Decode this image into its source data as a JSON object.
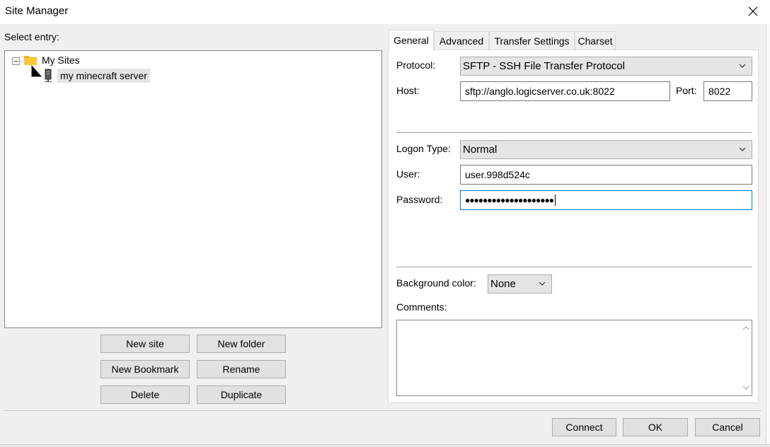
{
  "window": {
    "title": "Site Manager"
  },
  "tree": {
    "label": "Select entry:",
    "root": {
      "label": "My Sites",
      "expanded": true
    },
    "site": {
      "label": "my minecraft server"
    }
  },
  "left_buttons": {
    "new_site": "New site",
    "new_folder": "New folder",
    "new_bookmark": "New Bookmark",
    "rename": "Rename",
    "delete": "Delete",
    "duplicate": "Duplicate"
  },
  "tabs": [
    {
      "label": "General",
      "active": true
    },
    {
      "label": "Advanced",
      "active": false
    },
    {
      "label": "Transfer Settings",
      "active": false
    },
    {
      "label": "Charset",
      "active": false
    }
  ],
  "general": {
    "protocol_label": "Protocol:",
    "protocol_value": "SFTP - SSH File Transfer Protocol",
    "host_label": "Host:",
    "host_value": "sftp://anglo.logicserver.co.uk:8022",
    "port_label": "Port:",
    "port_value": "8022",
    "logon_type_label": "Logon Type:",
    "logon_type_value": "Normal",
    "user_label": "User:",
    "user_value": "user.998d524c",
    "password_label": "Password:",
    "password_value": "●●●●●●●●●●●●●●●●●●●●",
    "bg_color_label": "Background color:",
    "bg_color_value": "None",
    "comments_label": "Comments:",
    "comments_value": ""
  },
  "footer": {
    "connect": "Connect",
    "ok": "OK",
    "cancel": "Cancel"
  },
  "colors": {
    "dialog_bg": "#f0f0f0",
    "focus_border": "#0078d7",
    "folder": "#f4b400",
    "selection": "#e5e5e5"
  }
}
